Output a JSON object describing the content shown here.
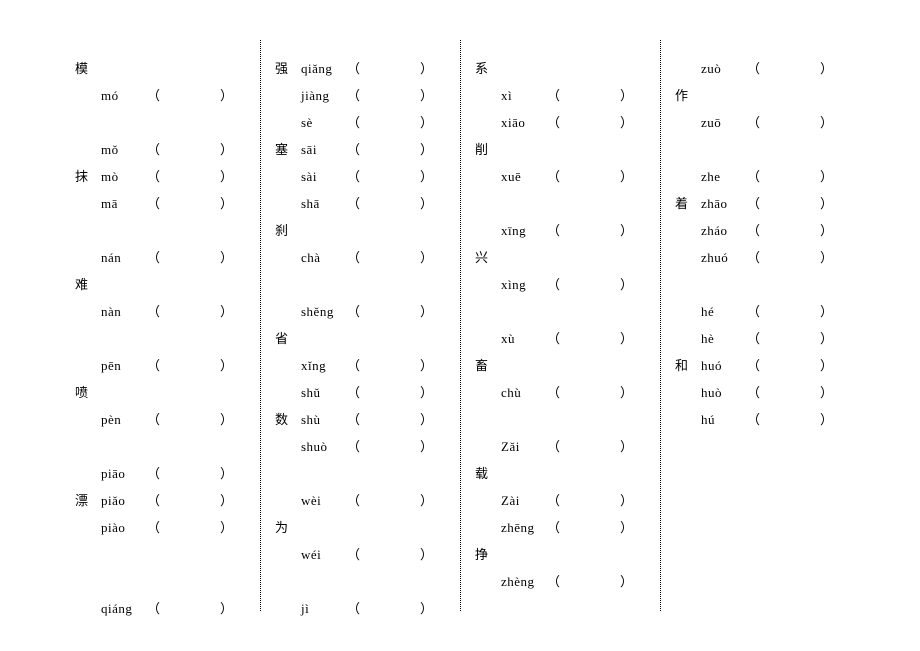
{
  "columns": [
    {
      "entries": [
        {
          "hanzi": "模",
          "pinyin": ""
        },
        {
          "hanzi": "",
          "pinyin": "mó"
        },
        {
          "hanzi": "",
          "pinyin": "",
          "blank": true
        },
        {
          "hanzi": "",
          "pinyin": "mǒ"
        },
        {
          "hanzi": "抹",
          "pinyin": "mò"
        },
        {
          "hanzi": "",
          "pinyin": "mā"
        },
        {
          "hanzi": "",
          "pinyin": "",
          "blank": true
        },
        {
          "hanzi": "",
          "pinyin": "nán"
        },
        {
          "hanzi": "难",
          "pinyin": ""
        },
        {
          "hanzi": "",
          "pinyin": "nàn"
        },
        {
          "hanzi": "",
          "pinyin": "",
          "blank": true
        },
        {
          "hanzi": "",
          "pinyin": "pēn"
        },
        {
          "hanzi": "喷",
          "pinyin": ""
        },
        {
          "hanzi": "",
          "pinyin": "pèn"
        },
        {
          "hanzi": "",
          "pinyin": "",
          "blank": true
        },
        {
          "hanzi": "",
          "pinyin": "piāo"
        },
        {
          "hanzi": "漂",
          "pinyin": "piǎo"
        },
        {
          "hanzi": "",
          "pinyin": "piào"
        },
        {
          "hanzi": "",
          "pinyin": "",
          "blank": true
        },
        {
          "hanzi": "",
          "pinyin": "",
          "blank": true
        },
        {
          "hanzi": "",
          "pinyin": "qiáng"
        }
      ]
    },
    {
      "entries": [
        {
          "hanzi": "强",
          "pinyin": "qiǎng"
        },
        {
          "hanzi": "",
          "pinyin": "jiàng"
        },
        {
          "hanzi": "",
          "pinyin": "sè"
        },
        {
          "hanzi": "塞",
          "pinyin": "sāi"
        },
        {
          "hanzi": "",
          "pinyin": "sài"
        },
        {
          "hanzi": "",
          "pinyin": "shā"
        },
        {
          "hanzi": "刹",
          "pinyin": ""
        },
        {
          "hanzi": "",
          "pinyin": "chà"
        },
        {
          "hanzi": "",
          "pinyin": "",
          "blank": true
        },
        {
          "hanzi": "",
          "pinyin": "shěng"
        },
        {
          "hanzi": "省",
          "pinyin": ""
        },
        {
          "hanzi": "",
          "pinyin": "xǐng"
        },
        {
          "hanzi": "",
          "pinyin": "shǔ"
        },
        {
          "hanzi": "数",
          "pinyin": "shù"
        },
        {
          "hanzi": "",
          "pinyin": "shuò"
        },
        {
          "hanzi": "",
          "pinyin": "",
          "blank": true
        },
        {
          "hanzi": "",
          "pinyin": "wèi"
        },
        {
          "hanzi": "为",
          "pinyin": ""
        },
        {
          "hanzi": "",
          "pinyin": "wéi"
        },
        {
          "hanzi": "",
          "pinyin": "",
          "blank": true
        },
        {
          "hanzi": "",
          "pinyin": "jì"
        }
      ]
    },
    {
      "entries": [
        {
          "hanzi": "系",
          "pinyin": ""
        },
        {
          "hanzi": "",
          "pinyin": "xì"
        },
        {
          "hanzi": "",
          "pinyin": "xiāo"
        },
        {
          "hanzi": "削",
          "pinyin": ""
        },
        {
          "hanzi": "",
          "pinyin": "xuē"
        },
        {
          "hanzi": "",
          "pinyin": "",
          "blank": true
        },
        {
          "hanzi": "",
          "pinyin": "xīng"
        },
        {
          "hanzi": "兴",
          "pinyin": ""
        },
        {
          "hanzi": "",
          "pinyin": "xìng"
        },
        {
          "hanzi": "",
          "pinyin": "",
          "blank": true
        },
        {
          "hanzi": "",
          "pinyin": "xù"
        },
        {
          "hanzi": "畜",
          "pinyin": ""
        },
        {
          "hanzi": "",
          "pinyin": "chù"
        },
        {
          "hanzi": "",
          "pinyin": "",
          "blank": true
        },
        {
          "hanzi": "",
          "pinyin": "Zǎi"
        },
        {
          "hanzi": "载",
          "pinyin": ""
        },
        {
          "hanzi": "",
          "pinyin": "Zài"
        },
        {
          "hanzi": "",
          "pinyin": "zhēng"
        },
        {
          "hanzi": "挣",
          "pinyin": ""
        },
        {
          "hanzi": "",
          "pinyin": "zhèng"
        }
      ]
    },
    {
      "entries": [
        {
          "hanzi": "",
          "pinyin": "zuò"
        },
        {
          "hanzi": "作",
          "pinyin": ""
        },
        {
          "hanzi": "",
          "pinyin": "zuō"
        },
        {
          "hanzi": "",
          "pinyin": "",
          "blank": true
        },
        {
          "hanzi": "",
          "pinyin": "zhe"
        },
        {
          "hanzi": "着",
          "pinyin": "zhāo"
        },
        {
          "hanzi": "",
          "pinyin": "zháo"
        },
        {
          "hanzi": "",
          "pinyin": "zhuó"
        },
        {
          "hanzi": "",
          "pinyin": "",
          "blank": true
        },
        {
          "hanzi": "",
          "pinyin": "hé"
        },
        {
          "hanzi": "",
          "pinyin": "hè"
        },
        {
          "hanzi": "和",
          "pinyin": "huó"
        },
        {
          "hanzi": "",
          "pinyin": "huò"
        },
        {
          "hanzi": "",
          "pinyin": "hú"
        }
      ]
    }
  ],
  "paren_open": "（",
  "paren_close": "）"
}
